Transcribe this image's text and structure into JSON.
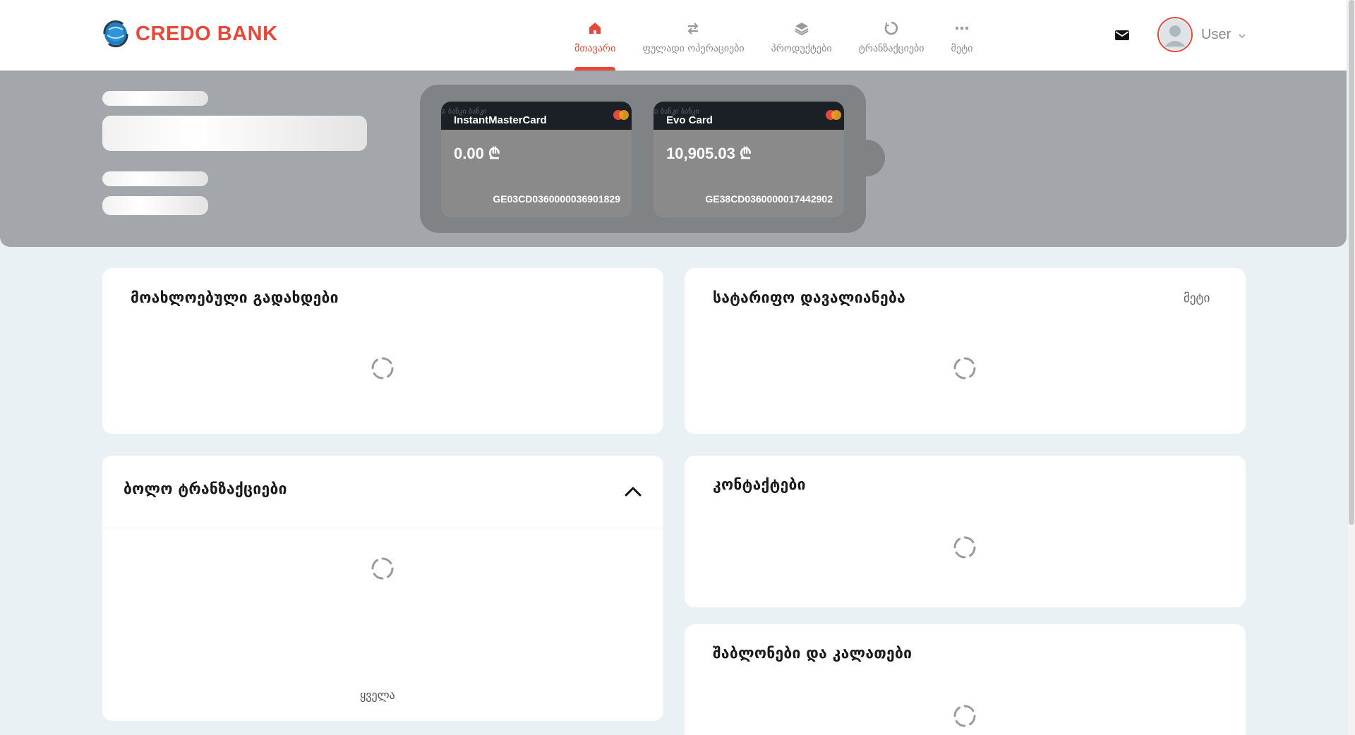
{
  "header": {
    "logo_text": "CREDO BANK",
    "nav": [
      {
        "label": "მთავარი",
        "icon": "home-icon",
        "active": true
      },
      {
        "label": "ფულადი ოპერაციები",
        "icon": "transfer-arrows-icon",
        "active": false
      },
      {
        "label": "პროდუქტები",
        "icon": "layers-icon",
        "active": false
      },
      {
        "label": "ტრანზაქციები",
        "icon": "history-icon",
        "active": false
      },
      {
        "label": "მეტი",
        "icon": "more-dots-icon",
        "active": false
      }
    ],
    "user_name": "User",
    "mail_icon": "mail-icon"
  },
  "cards": [
    {
      "name": "InstantMasterCard",
      "balance": "0.00 ₾",
      "iban": "GE03CD0360000036901829",
      "bank_mark": "◎ ბანკი ბანკი"
    },
    {
      "name": "Evo Card",
      "balance": "10,905.03 ₾",
      "iban": "GE38CD0360000017442902",
      "bank_mark": "◎ ბანკი ბანკი"
    }
  ],
  "widgets": {
    "upcoming_payments": {
      "title": "მოახლოებული გადახდები"
    },
    "tariff_debt": {
      "title": "სატარიფო დავალიანება",
      "more": "მეტი"
    },
    "recent_transactions": {
      "title": "ბოლო ტრანზაქციები",
      "all_link": "ყველა"
    },
    "contacts": {
      "title": "კონტაქტები"
    },
    "templates": {
      "title": "შაბლონები და კალათები"
    }
  },
  "colors": {
    "brand": "#e5493a",
    "hero_bg": "#a3a7ab",
    "page_bg": "#eaf1f4"
  }
}
